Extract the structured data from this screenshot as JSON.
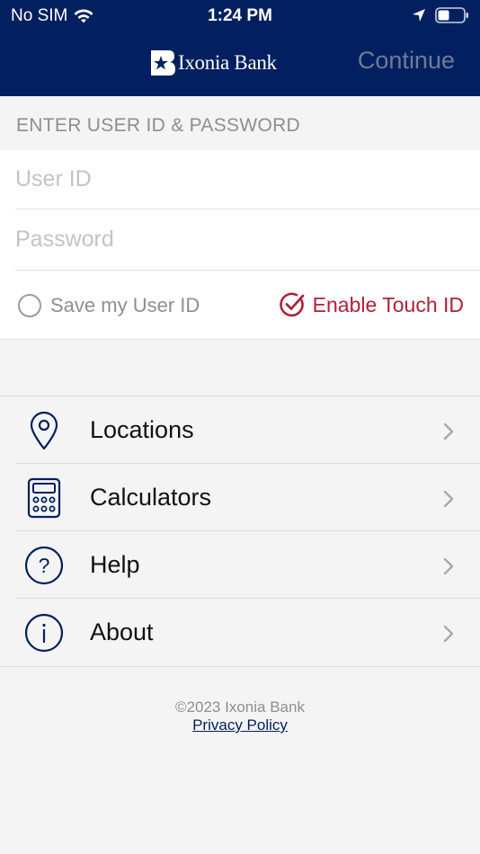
{
  "status_bar": {
    "carrier": "No SIM",
    "time": "1:24 PM",
    "icons": [
      "wifi-icon",
      "location-arrow-icon",
      "battery-icon"
    ]
  },
  "header": {
    "logo_text": "Ixonia Bank",
    "continue_label": "Continue",
    "background_color": "#02205f"
  },
  "login": {
    "section_title": "ENTER USER ID & PASSWORD",
    "user_id_placeholder": "User ID",
    "user_id_value": "",
    "password_placeholder": "Password",
    "password_value": "",
    "save_user_id_label": "Save my User ID",
    "save_user_id_checked": false,
    "touch_id_label": "Enable Touch ID",
    "touch_id_checked": true,
    "accent_color": "#b0203a"
  },
  "menu": {
    "items": [
      {
        "label": "Locations",
        "icon": "location-pin-icon"
      },
      {
        "label": "Calculators",
        "icon": "calculator-icon"
      },
      {
        "label": "Help",
        "icon": "question-circle-icon"
      },
      {
        "label": "About",
        "icon": "info-circle-icon"
      }
    ]
  },
  "footer": {
    "copyright": "©2023 Ixonia Bank",
    "privacy_link": "Privacy Policy"
  }
}
